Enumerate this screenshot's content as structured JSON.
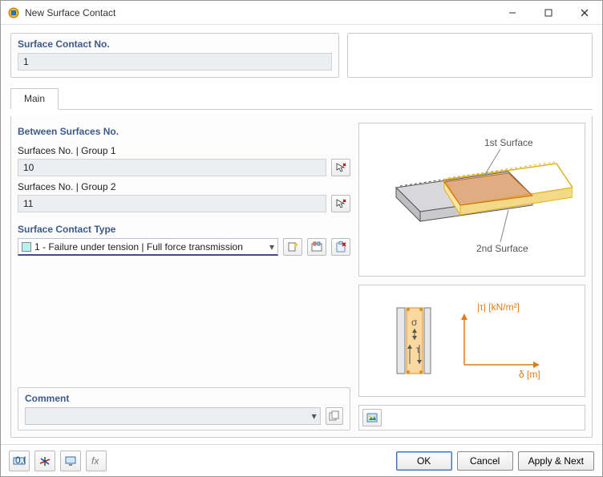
{
  "window": {
    "title": "New Surface Contact"
  },
  "surface_contact_no": {
    "label": "Surface Contact No.",
    "value": "1"
  },
  "tabs": {
    "main": "Main"
  },
  "between": {
    "heading": "Between Surfaces No.",
    "group1_label": "Surfaces No. | Group 1",
    "group1_value": "10",
    "group2_label": "Surfaces No. | Group 2",
    "group2_value": "11"
  },
  "contact_type": {
    "heading": "Surface Contact Type",
    "selected": "1 - Failure under tension | Full force transmission"
  },
  "comment": {
    "heading": "Comment",
    "value": ""
  },
  "preview": {
    "first_surface": "1st Surface",
    "second_surface": "2nd Surface",
    "yaxis": "|τ| [kN/m²]",
    "xaxis": "δ [m]",
    "sigma": "σ",
    "tau": "τ"
  },
  "buttons": {
    "ok": "OK",
    "cancel": "Cancel",
    "apply_next": "Apply & Next"
  }
}
